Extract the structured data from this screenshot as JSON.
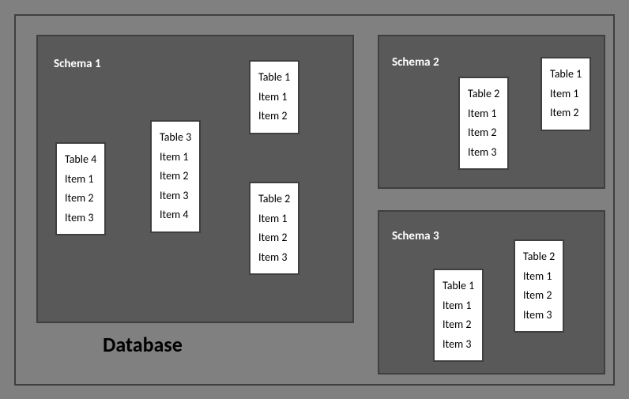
{
  "db_label": "Database",
  "schemas": {
    "s1": {
      "label": "Schema 1",
      "tables": {
        "t4": {
          "name": "Table 4",
          "items": [
            "Item 1",
            "Item 2",
            "Item 3"
          ]
        },
        "t3": {
          "name": "Table 3",
          "items": [
            "Item 1",
            "Item 2",
            "Item 3",
            "Item 4"
          ]
        },
        "t1": {
          "name": "Table 1",
          "items": [
            "Item 1",
            "Item 2"
          ]
        },
        "t2": {
          "name": "Table 2",
          "items": [
            "Item 1",
            "Item 2",
            "Item 3"
          ]
        }
      }
    },
    "s2": {
      "label": "Schema 2",
      "tables": {
        "t2": {
          "name": "Table 2",
          "items": [
            "Item 1",
            "Item 2",
            "Item 3"
          ]
        },
        "t1": {
          "name": "Table 1",
          "items": [
            "Item 1",
            "Item 2"
          ]
        }
      }
    },
    "s3": {
      "label": "Schema 3",
      "tables": {
        "t1": {
          "name": "Table 1",
          "items": [
            "Item 1",
            "Item 2",
            "Item 3"
          ]
        },
        "t2": {
          "name": "Table 2",
          "items": [
            "Item 1",
            "Item 2",
            "Item 3"
          ]
        }
      }
    }
  }
}
